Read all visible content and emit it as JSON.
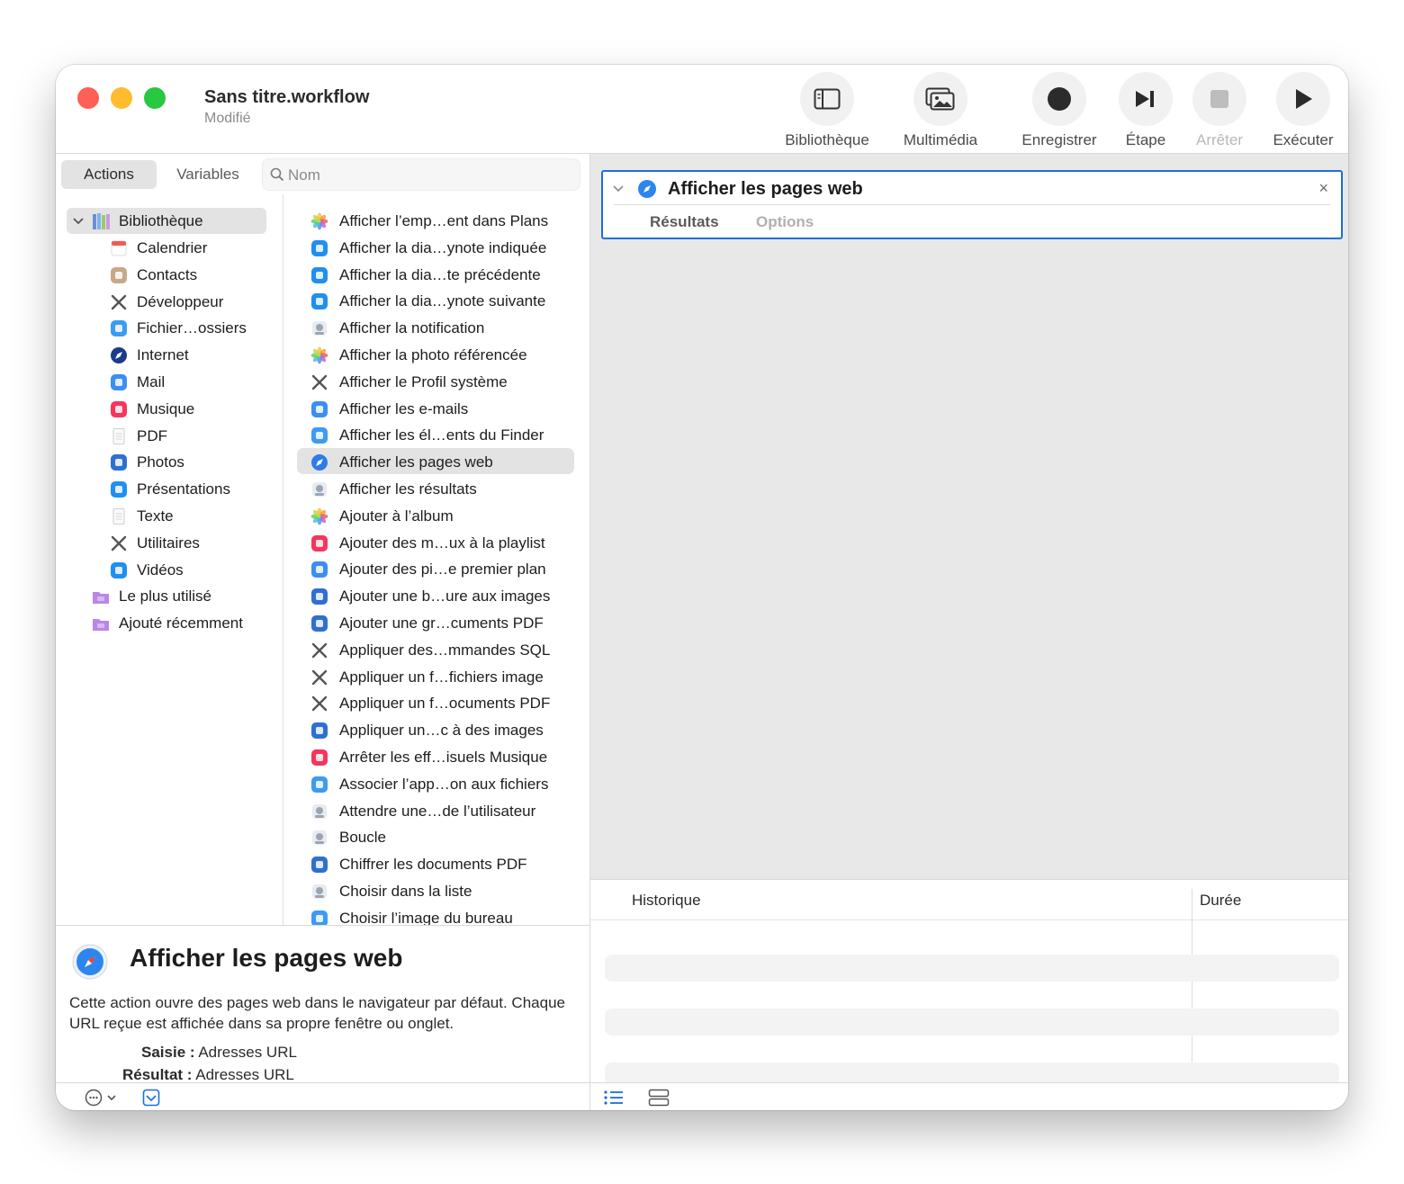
{
  "window": {
    "title": "Sans titre.workflow",
    "subtitle": "Modifié"
  },
  "toolbar": {
    "library": "Bibliothèque",
    "media": "Multimédia",
    "record": "Enregistrer",
    "step": "Étape",
    "stop": "Arrêter",
    "run": "Exécuter"
  },
  "tabs": {
    "actions": "Actions",
    "variables": "Variables"
  },
  "search": {
    "placeholder": "Nom"
  },
  "library": {
    "root": "Bibliothèque",
    "items": [
      {
        "label": "Calendrier",
        "icon": "calendar-icon",
        "color": "#f25b52"
      },
      {
        "label": "Contacts",
        "icon": "contacts-icon",
        "color": "#c9a88a"
      },
      {
        "label": "Développeur",
        "icon": "developer-tools-icon",
        "color": "#555555"
      },
      {
        "label": "Fichier…ossiers",
        "icon": "finder-icon",
        "color": "#3d9bf1"
      },
      {
        "label": "Internet",
        "icon": "internet-globe-icon",
        "color": "#1b3a8a"
      },
      {
        "label": "Mail",
        "icon": "mail-icon",
        "color": "#3c8ef3"
      },
      {
        "label": "Musique",
        "icon": "music-icon",
        "color": "#f5365c"
      },
      {
        "label": "PDF",
        "icon": "pdf-icon",
        "color": "#e6e6e6"
      },
      {
        "label": "Photos",
        "icon": "photos-icon",
        "color": "#2f6fd1"
      },
      {
        "label": "Présentations",
        "icon": "keynote-icon",
        "color": "#1f8ff0"
      },
      {
        "label": "Texte",
        "icon": "text-icon",
        "color": "#eeeeee"
      },
      {
        "label": "Utilitaires",
        "icon": "utilities-icon",
        "color": "#555555"
      },
      {
        "label": "Vidéos",
        "icon": "quicktime-icon",
        "color": "#1f8ff0"
      }
    ],
    "smart": [
      {
        "label": "Le plus utilisé",
        "icon": "smart-folder-icon",
        "color": "#b987e6"
      },
      {
        "label": "Ajouté récemment",
        "icon": "smart-folder-icon",
        "color": "#b987e6"
      }
    ]
  },
  "actions": [
    {
      "label": "Afficher l’emp…ent dans Plans",
      "icon": "photos-flower-icon",
      "color": "#f4a13a"
    },
    {
      "label": "Afficher la dia…ynote indiquée",
      "icon": "keynote-icon",
      "color": "#1f8ff0"
    },
    {
      "label": "Afficher la dia…te précédente",
      "icon": "keynote-icon",
      "color": "#1f8ff0"
    },
    {
      "label": "Afficher la dia…ynote suivante",
      "icon": "keynote-icon",
      "color": "#1f8ff0"
    },
    {
      "label": "Afficher la notification",
      "icon": "automator-icon",
      "color": "#9aa6b3"
    },
    {
      "label": "Afficher la photo référencée",
      "icon": "photos-flower-icon",
      "color": "#f4a13a"
    },
    {
      "label": "Afficher le Profil système",
      "icon": "utilities-icon",
      "color": "#555555"
    },
    {
      "label": "Afficher les e-mails",
      "icon": "mail-icon",
      "color": "#3c8ef3"
    },
    {
      "label": "Afficher les él…ents du Finder",
      "icon": "finder-icon",
      "color": "#3d9bf1"
    },
    {
      "label": "Afficher les pages web",
      "icon": "safari-icon",
      "color": "#2d7de5"
    },
    {
      "label": "Afficher les résultats",
      "icon": "automator-icon",
      "color": "#9aa6b3"
    },
    {
      "label": "Ajouter à l’album",
      "icon": "photos-flower-icon",
      "color": "#f4a13a"
    },
    {
      "label": "Ajouter des m…ux à la playlist",
      "icon": "music-icon",
      "color": "#f5365c"
    },
    {
      "label": "Ajouter des pi…e premier plan",
      "icon": "mail-icon",
      "color": "#3c8ef3"
    },
    {
      "label": "Ajouter une b…ure aux images",
      "icon": "preview-icon",
      "color": "#2f6fd1"
    },
    {
      "label": "Ajouter une gr…cuments PDF",
      "icon": "preview-icon",
      "color": "#2f6fd1"
    },
    {
      "label": "Appliquer des…mmandes SQL",
      "icon": "utilities-icon",
      "color": "#555555"
    },
    {
      "label": "Appliquer un f…fichiers image",
      "icon": "utilities-icon",
      "color": "#555555"
    },
    {
      "label": "Appliquer un f…ocuments PDF",
      "icon": "utilities-icon",
      "color": "#555555"
    },
    {
      "label": "Appliquer un…c à des images",
      "icon": "preview-icon",
      "color": "#2f6fd1"
    },
    {
      "label": "Arrêter les eff…isuels Musique",
      "icon": "music-icon",
      "color": "#f5365c"
    },
    {
      "label": "Associer l’app…on aux fichiers",
      "icon": "finder-icon",
      "color": "#3d9bf1"
    },
    {
      "label": "Attendre une…de l’utilisateur",
      "icon": "automator-icon",
      "color": "#9aa6b3"
    },
    {
      "label": "Boucle",
      "icon": "automator-icon",
      "color": "#9aa6b3"
    },
    {
      "label": "Chiffrer les documents PDF",
      "icon": "preview-icon",
      "color": "#2f6fd1"
    },
    {
      "label": "Choisir dans la liste",
      "icon": "automator-icon",
      "color": "#9aa6b3"
    },
    {
      "label": "Choisir l’image du bureau",
      "icon": "finder-icon",
      "color": "#3d9bf1"
    }
  ],
  "description": {
    "title": "Afficher les pages web",
    "body": "Cette action ouvre des pages web dans le navigateur par défaut. Chaque URL reçue est affichée dans sa propre fenêtre ou onglet.",
    "input_label": "Saisie :",
    "input_value": "Adresses URL",
    "output_label": "Résultat :",
    "output_value": "Adresses URL"
  },
  "workflow_action": {
    "title": "Afficher les pages web",
    "tab_results": "Résultats",
    "tab_options": "Options",
    "close": "×"
  },
  "history": {
    "col_history": "Historique",
    "col_duration": "Durée"
  },
  "colors": {
    "accent": "#1a6fdb",
    "selection": "#e3e3e3"
  }
}
